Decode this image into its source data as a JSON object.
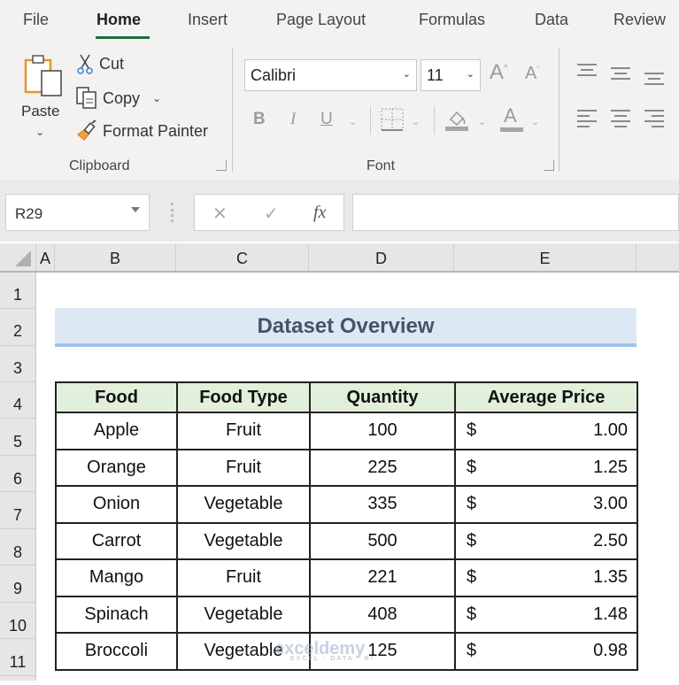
{
  "ribbon": {
    "tabs": [
      {
        "label": "File",
        "active": false
      },
      {
        "label": "Home",
        "active": true
      },
      {
        "label": "Insert",
        "active": false
      },
      {
        "label": "Page Layout",
        "active": false
      },
      {
        "label": "Formulas",
        "active": false
      },
      {
        "label": "Data",
        "active": false
      },
      {
        "label": "Review",
        "active": false
      }
    ],
    "accent_color": "#1e6e3f",
    "clipboard": {
      "paste_label": "Paste",
      "cut_label": "Cut",
      "copy_label": "Copy",
      "format_painter_label": "Format Painter",
      "group_label": "Clipboard"
    },
    "font": {
      "font_name": "Calibri",
      "font_size": "11",
      "bold": "B",
      "italic": "I",
      "underline": "U",
      "increase_font": "A",
      "decrease_font": "A",
      "font_color": "A",
      "group_label": "Font"
    }
  },
  "formula_bar": {
    "name_box": "R29",
    "cancel_symbol": "✕",
    "enter_symbol": "✓",
    "fx_symbol": "fx",
    "formula_value": ""
  },
  "sheet": {
    "columns": [
      "A",
      "B",
      "C",
      "D",
      "E"
    ],
    "rows": [
      "1",
      "2",
      "3",
      "4",
      "5",
      "6",
      "7",
      "8",
      "9",
      "10",
      "11"
    ],
    "title": "Dataset Overview",
    "headers": [
      "Food",
      "Food Type",
      "Quantity",
      "Average Price"
    ],
    "data": [
      {
        "food": "Apple",
        "type": "Fruit",
        "quantity": "100",
        "currency": "$",
        "price": "1.00"
      },
      {
        "food": "Orange",
        "type": "Fruit",
        "quantity": "225",
        "currency": "$",
        "price": "1.25"
      },
      {
        "food": "Onion",
        "type": "Vegetable",
        "quantity": "335",
        "currency": "$",
        "price": "3.00"
      },
      {
        "food": "Carrot",
        "type": "Vegetable",
        "quantity": "500",
        "currency": "$",
        "price": "2.50"
      },
      {
        "food": "Mango",
        "type": "Fruit",
        "quantity": "221",
        "currency": "$",
        "price": "1.35"
      },
      {
        "food": "Spinach",
        "type": "Vegetable",
        "quantity": "408",
        "currency": "$",
        "price": "1.48"
      },
      {
        "food": "Broccoli",
        "type": "Vegetable",
        "quantity": "125",
        "currency": "$",
        "price": "0.98"
      }
    ]
  },
  "watermark": {
    "brand": "exceldemy",
    "tagline": "EXCEL · DATA · BI"
  }
}
